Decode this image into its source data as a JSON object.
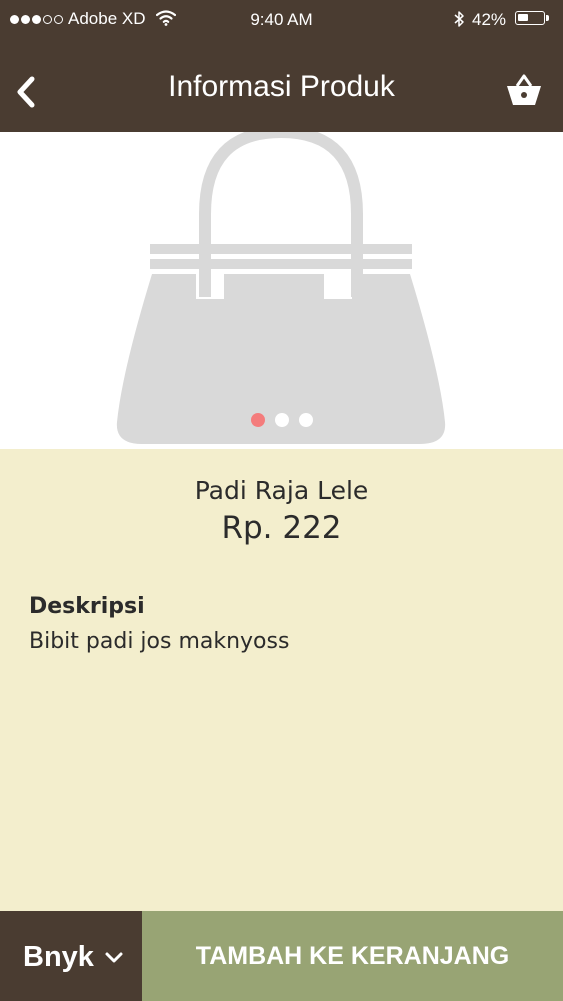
{
  "status_bar": {
    "carrier": "Adobe XD",
    "time": "9:40 AM",
    "battery": "42%",
    "battery_level": 0.42,
    "signal_bars_filled": 3,
    "signal_bars_total": 5,
    "icons": [
      "wifi-icon",
      "bluetooth-icon",
      "battery-icon"
    ]
  },
  "header": {
    "title": "Informasi Produk",
    "back_icon": "chevron-left-icon",
    "cart_icon": "basket-icon"
  },
  "product": {
    "image_icon": "handbag-icon",
    "carousel": {
      "count": 3,
      "active_index": 0
    },
    "name": "Padi Raja Lele",
    "price": "Rp. 222",
    "description_label": "Deskripsi",
    "description": "Bibit padi jos maknyoss"
  },
  "footer": {
    "quantity_label": "Bnyk",
    "quantity_icon": "chevron-down-icon",
    "add_to_cart_label": "TAMBAH KE KERANJANG"
  },
  "colors": {
    "header_bg": "#4a3c31",
    "info_bg": "#f3eecd",
    "button_bg": "#98a474",
    "active_dot": "#f47c7c",
    "image_placeholder": "#d9d9d9"
  }
}
